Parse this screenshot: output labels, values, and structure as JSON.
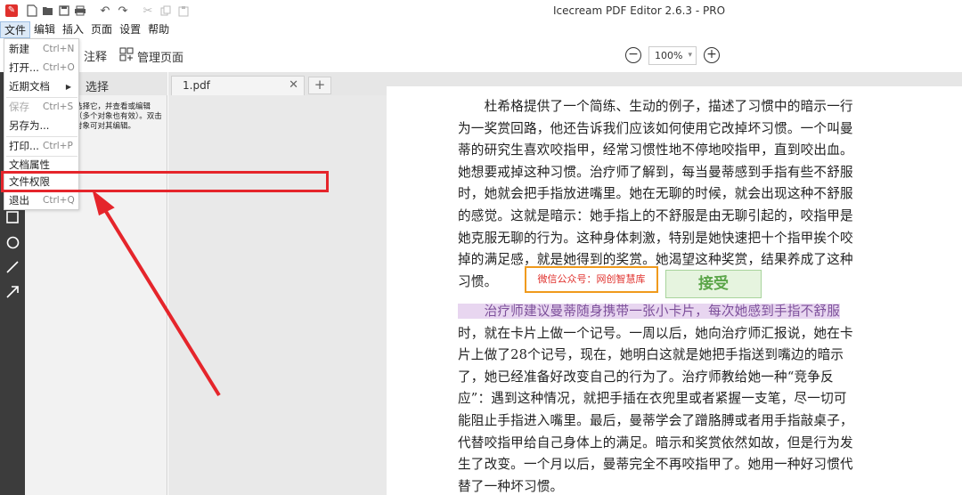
{
  "app": {
    "title": "Icecream PDF Editor 2.6.3 - PRO",
    "logo_glyph": "✎"
  },
  "quick_toolbar": [
    "new-file-icon",
    "open-icon",
    "save-icon",
    "print-icon",
    "undo-icon",
    "redo-icon",
    "cut-icon",
    "copy-icon",
    "paste-icon"
  ],
  "menubar": {
    "file": "文件",
    "edit": "编辑",
    "insert": "插入",
    "page": "页面",
    "settings": "设置",
    "help": "帮助"
  },
  "toolbar": {
    "annotate": "注释",
    "manage_pages": "管理页面",
    "zoom_value": "100%",
    "zoom_caret": "▾",
    "zoom_minus": "−",
    "zoom_plus": "+"
  },
  "panel": {
    "title": "选择",
    "hint": "选择它，并查看或编辑（多个对象也有效）。双击对象可对其编辑。"
  },
  "tabs": {
    "doc_name": "1.pdf",
    "close_glyph": "✕",
    "new_tab_glyph": "+"
  },
  "file_menu": {
    "new": {
      "label": "新建",
      "shortcut": "Ctrl+N"
    },
    "open": {
      "label": "打开...",
      "shortcut": "Ctrl+O"
    },
    "recent": {
      "label": "近期文档",
      "arrow": "▶"
    },
    "save": {
      "label": "保存",
      "shortcut": "Ctrl+S"
    },
    "save_as": {
      "label": "另存为..."
    },
    "print": {
      "label": "打印...",
      "shortcut": "Ctrl+P"
    },
    "properties": {
      "label": "文档属性"
    },
    "permissions": {
      "label": "文件权限"
    },
    "exit": {
      "label": "退出",
      "shortcut": "Ctrl+Q"
    }
  },
  "document": {
    "para1": [
      "　　杜希格提供了一个简练、生动的例子，描述了习惯中的暗示一行",
      "为一奖赏回路，他还告诉我们应该如何使用它改掉坏习惯。一个叫曼",
      "蒂的研究生喜欢咬指甲，经常习惯性地不停地咬指甲，直到咬出血。",
      "她想要戒掉这种习惯。治疗师了解到，每当曼蒂感到手指有些不舒服",
      "时，她就会把手指放进嘴里。她在无聊的时候，就会出现这种不舒服",
      "的感觉。这就是暗示：她手指上的不舒服是由无聊引起的，咬指甲是",
      "她克服无聊的行为。这种身体刺激，特别是她快速把十个指甲挨个咬",
      "掉的满足感，就是她得到的奖赏。她渴望这种奖赏，结果养成了这种",
      "习惯。"
    ],
    "para2_highlight": "　　治疗师建议曼蒂随身携带一张小卡片，每次她感到手指不舒服",
    "para2": [
      "时，就在卡片上做一个记号。一周以后，她向治疗师汇报说，她在卡",
      "片上做了28个记号，现在，她明白这就是她把手指送到嘴边的暗示",
      "了，她已经准备好改变自己的行为了。治疗师教给她一种“竞争反",
      "应”：遇到这种情况，就把手插在衣兜里或者紧握一支笔，尽一切可",
      "能阻止手指进入嘴里。最后，曼蒂学会了蹭胳膊或者用手指敲桌子，",
      "代替咬指甲给自己身体上的满足。暗示和奖赏依然如故，但是行为发",
      "生了改变。一个月以后，曼蒂完全不再咬指甲了。她用一种好习惯代",
      "替了一种坏习惯。"
    ],
    "stamp_wechat": "微信公众号：网创智慧库",
    "stamp_accept": "接受"
  },
  "colors": {
    "accent_red": "#e5252b",
    "strip_bg": "#3c3c3c",
    "stamp_orange": "#f09a1c",
    "stamp_green": "#5aa548"
  }
}
